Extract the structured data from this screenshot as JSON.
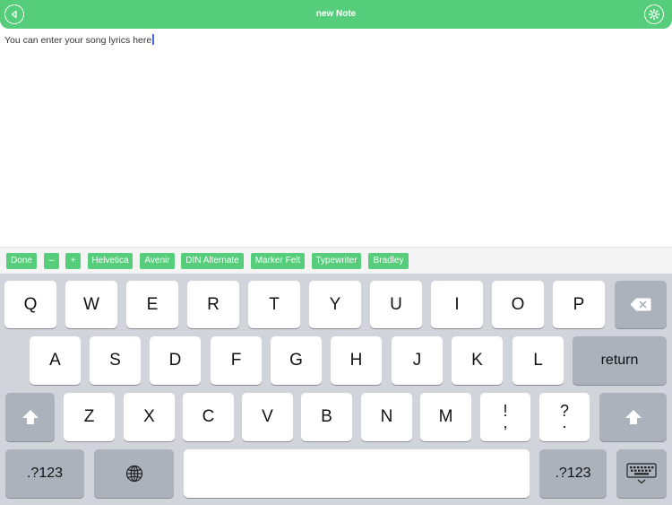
{
  "header": {
    "title": "new Note",
    "back_icon": "back-arrow-icon",
    "settings_icon": "gear-icon",
    "color": "#56cd7a"
  },
  "editor": {
    "text": "You can enter your song lyrics here"
  },
  "accessory": {
    "buttons": [
      "Done",
      "–",
      "+",
      "Helvetica",
      "Avenir",
      "DIN Alternate",
      "Marker Felt",
      "Typewriter",
      "Bradley"
    ]
  },
  "keyboard": {
    "row1": [
      "Q",
      "W",
      "E",
      "R",
      "T",
      "Y",
      "U",
      "I",
      "O",
      "P"
    ],
    "row2": [
      "A",
      "S",
      "D",
      "F",
      "G",
      "H",
      "J",
      "K",
      "L"
    ],
    "row3": [
      "Z",
      "X",
      "C",
      "V",
      "B",
      "N",
      "M"
    ],
    "punct1": [
      "!",
      ","
    ],
    "punct2": [
      "?",
      "."
    ],
    "return_label": "return",
    "numbers_label": ".?123",
    "backspace_icon": "backspace-icon",
    "shift_icon": "shift-arrow-icon",
    "globe_icon": "globe-icon",
    "hide_keyboard_icon": "keyboard-dismiss-icon"
  }
}
